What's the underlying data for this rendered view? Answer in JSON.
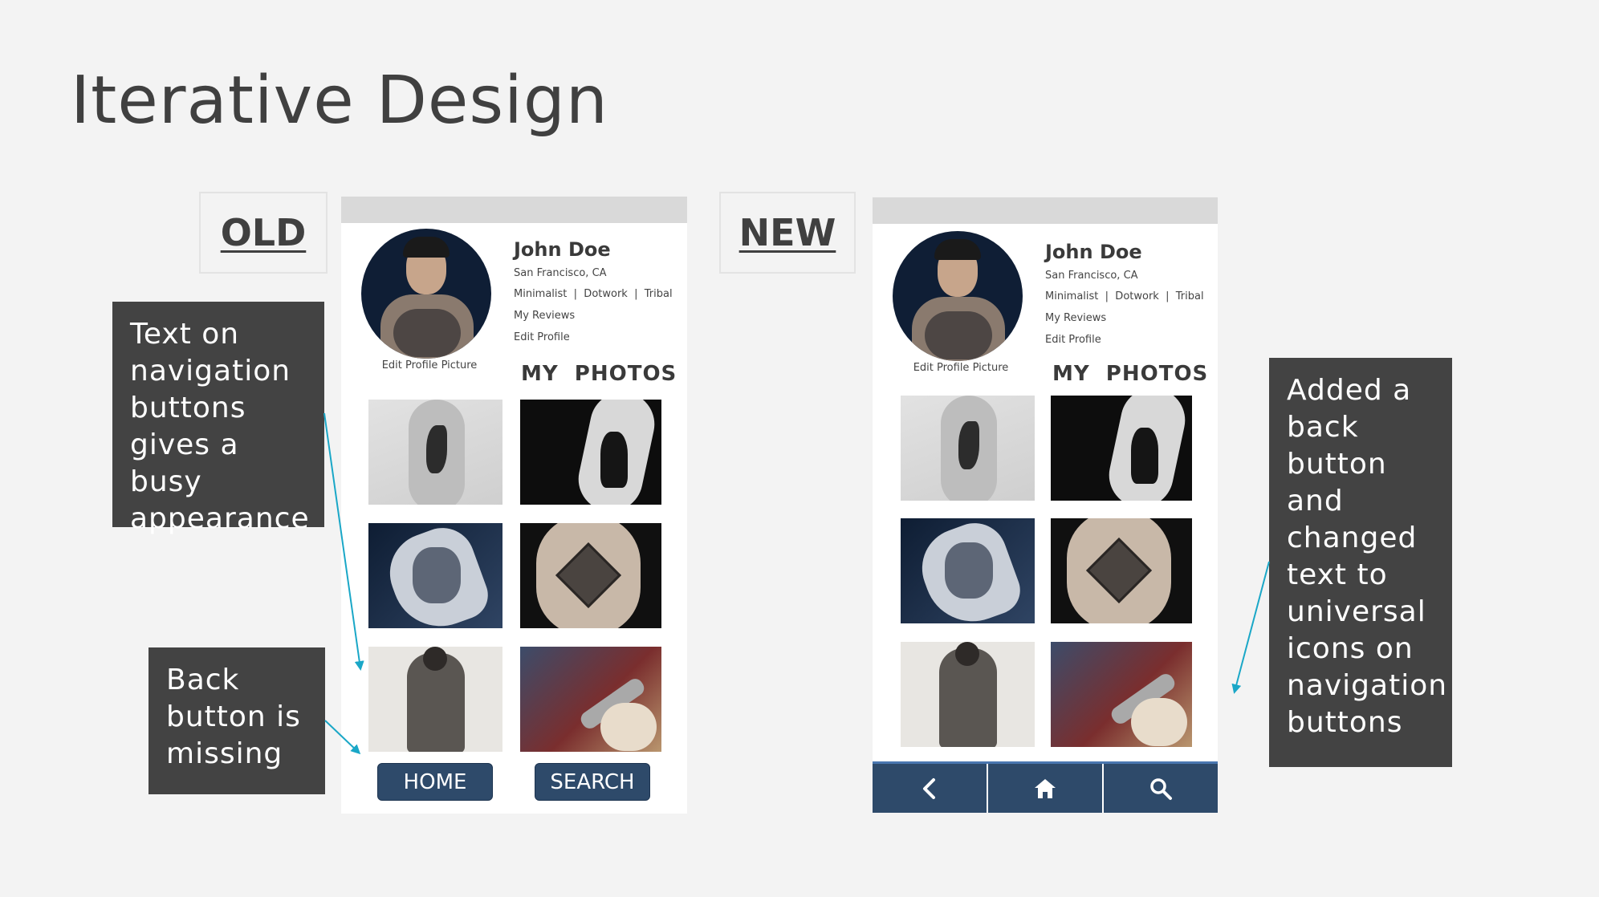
{
  "slide": {
    "title": "Iterative Design"
  },
  "labels": {
    "old": "OLD",
    "new": "NEW"
  },
  "notes": {
    "busy": "Text on navigation buttons gives a busy appearance",
    "back_missing": "Back button is missing",
    "added": "Added a back button and changed text to universal icons on navigation buttons"
  },
  "profile": {
    "name": "John Doe",
    "location": "San Francisco, CA",
    "styles": "Minimalist  |  Dotwork  |  Tribal",
    "reviews": "My Reviews",
    "edit_profile": "Edit Profile",
    "edit_picture": "Edit Profile Picture",
    "photos_heading": "MY  PHOTOS"
  },
  "old_nav": {
    "home": "HOME",
    "search": "SEARCH"
  },
  "new_nav": {
    "icons": [
      "chevron-left-icon",
      "home-icon",
      "search-icon"
    ]
  },
  "colors": {
    "nav": "#2e4a6a",
    "accent_arrow": "#1aa7c7",
    "note_bg": "#434343"
  }
}
